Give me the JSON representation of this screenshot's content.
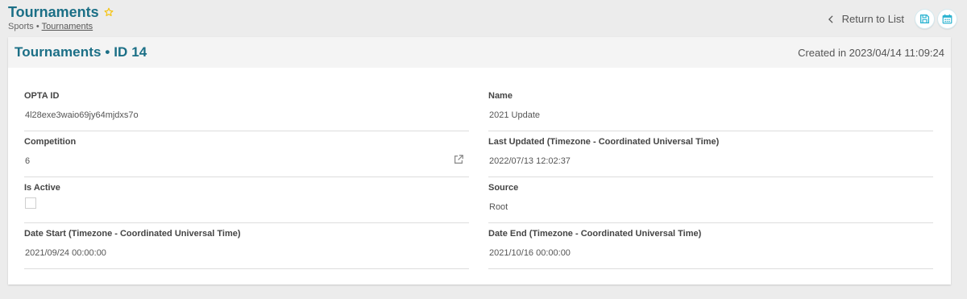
{
  "header": {
    "title": "Tournaments",
    "breadcrumb": {
      "parent": "Sports",
      "separator": "•",
      "current": "Tournaments"
    },
    "return_label": "Return to List"
  },
  "card": {
    "title": "Tournaments • ID 14",
    "created": "Created in 2023/04/14 11:09:24"
  },
  "fields": {
    "opta_id": {
      "label": "OPTA ID",
      "value": "4l28exe3waio69jy64mjdxs7o"
    },
    "name": {
      "label": "Name",
      "value": "2021 Update"
    },
    "competition": {
      "label": "Competition",
      "value": "6"
    },
    "last_updated": {
      "label": "Last Updated (Timezone - Coordinated Universal Time)",
      "value": "2022/07/13 12:02:37"
    },
    "is_active": {
      "label": "Is Active"
    },
    "source": {
      "label": "Source",
      "value": "Root"
    },
    "date_start": {
      "label": "Date Start (Timezone - Coordinated Universal Time)",
      "value": "2021/09/24 00:00:00"
    },
    "date_end": {
      "label": "Date End (Timezone - Coordinated Universal Time)",
      "value": "2021/10/16 00:00:00"
    }
  },
  "icons": {
    "star": "star-icon",
    "return": "chevron-left-icon",
    "save": "save-icon",
    "calendar": "calendar-icon",
    "external": "external-link-icon"
  },
  "colors": {
    "accent": "#1b6f86",
    "star": "#f5c518",
    "icon": "#2bb3d1"
  }
}
